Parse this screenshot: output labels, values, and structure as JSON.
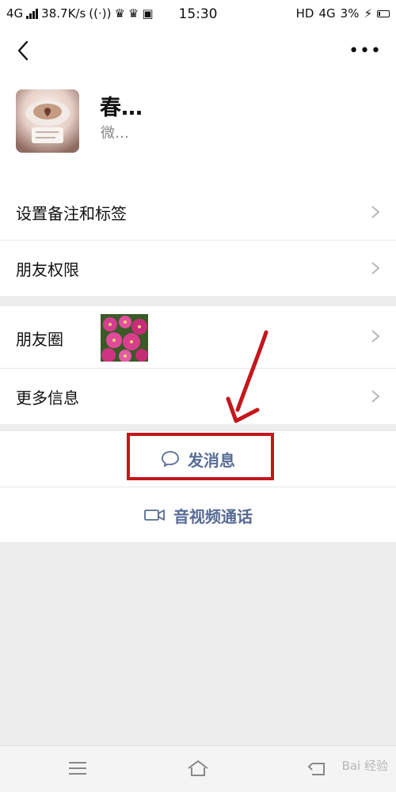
{
  "status_bar": {
    "network": "4G",
    "speed": "38.7K/s",
    "time": "15:30",
    "hd": "HD",
    "network_right": "4G",
    "battery": "3%"
  },
  "profile": {
    "name": "春…",
    "wechat_id": "微…"
  },
  "menu": {
    "set_remark_tags": "设置备注和标签",
    "friend_permissions": "朋友权限",
    "moments": "朋友圈",
    "more_info": "更多信息"
  },
  "actions": {
    "send_message": "发消息",
    "video_call": "音视频通话"
  },
  "colors": {
    "accent": "#576b95",
    "highlight": "#c4161c"
  },
  "watermark": "Bai 经验"
}
